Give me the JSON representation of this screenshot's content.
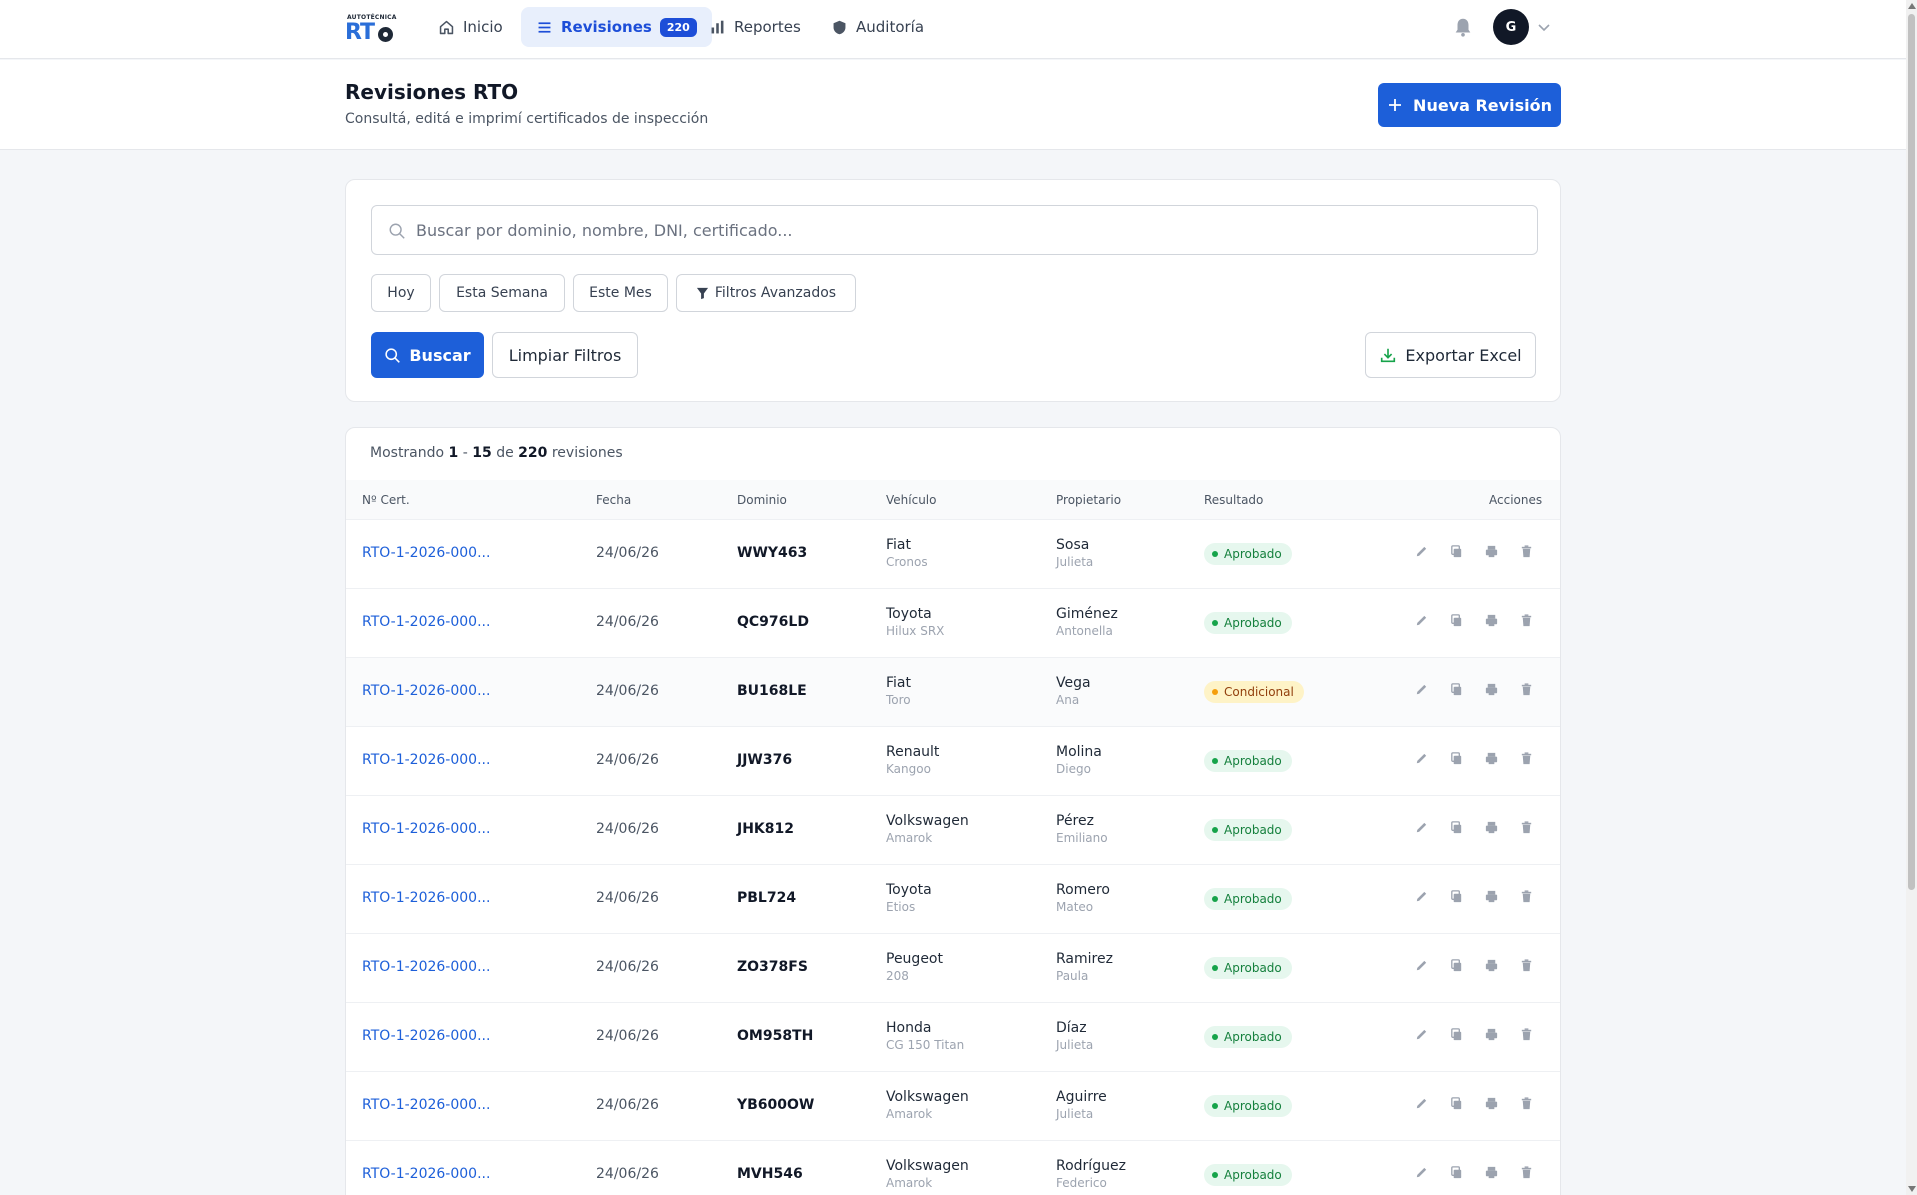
{
  "brand": {
    "top": "AUTOTÉCNICA",
    "main": "RT"
  },
  "nav": {
    "items": [
      {
        "label": "Inicio",
        "icon": "home-icon"
      },
      {
        "label": "Revisiones",
        "icon": "list-icon",
        "badge": "220",
        "active": true
      },
      {
        "label": "Reportes",
        "icon": "bar-chart-icon"
      },
      {
        "label": "Auditoría",
        "icon": "shield-icon"
      }
    ],
    "avatar": "G"
  },
  "header": {
    "title": "Revisiones RTO",
    "subtitle": "Consultá, editá e imprimí certificados de inspección",
    "new_button": "Nueva Revisión"
  },
  "filters": {
    "search_placeholder": "Buscar por dominio, nombre, DNI, certificado...",
    "quick": [
      "Hoy",
      "Esta Semana",
      "Este Mes"
    ],
    "advanced": "Filtros Avanzados",
    "search_button": "Buscar",
    "clear_button": "Limpiar Filtros",
    "export_button": "Exportar Excel"
  },
  "results": {
    "prefix": "Mostrando",
    "from": "1",
    "dash": "-",
    "to": "15",
    "of": "de",
    "total": "220",
    "suffix": "revisiones"
  },
  "table": {
    "headers": [
      "Nº Cert.",
      "Fecha",
      "Dominio",
      "Vehículo",
      "Propietario",
      "Resultado",
      "Acciones"
    ],
    "rows": [
      {
        "cert": "RTO-1-2026-000...",
        "fecha": "24/06/26",
        "dominio": "WWY463",
        "marca": "Fiat",
        "modelo": "Cronos",
        "apellido": "Sosa",
        "nombre": "Julieta",
        "resultado": "Aprobado"
      },
      {
        "cert": "RTO-1-2026-000...",
        "fecha": "24/06/26",
        "dominio": "QC976LD",
        "marca": "Toyota",
        "modelo": "Hilux SRX",
        "apellido": "Giménez",
        "nombre": "Antonella",
        "resultado": "Aprobado"
      },
      {
        "cert": "RTO-1-2026-000...",
        "fecha": "24/06/26",
        "dominio": "BU168LE",
        "marca": "Fiat",
        "modelo": "Toro",
        "apellido": "Vega",
        "nombre": "Ana",
        "resultado": "Condicional"
      },
      {
        "cert": "RTO-1-2026-000...",
        "fecha": "24/06/26",
        "dominio": "JJW376",
        "marca": "Renault",
        "modelo": "Kangoo",
        "apellido": "Molina",
        "nombre": "Diego",
        "resultado": "Aprobado"
      },
      {
        "cert": "RTO-1-2026-000...",
        "fecha": "24/06/26",
        "dominio": "JHK812",
        "marca": "Volkswagen",
        "modelo": "Amarok",
        "apellido": "Pérez",
        "nombre": "Emiliano",
        "resultado": "Aprobado"
      },
      {
        "cert": "RTO-1-2026-000...",
        "fecha": "24/06/26",
        "dominio": "PBL724",
        "marca": "Toyota",
        "modelo": "Etios",
        "apellido": "Romero",
        "nombre": "Mateo",
        "resultado": "Aprobado"
      },
      {
        "cert": "RTO-1-2026-000...",
        "fecha": "24/06/26",
        "dominio": "ZO378FS",
        "marca": "Peugeot",
        "modelo": "208",
        "apellido": "Ramirez",
        "nombre": "Paula",
        "resultado": "Aprobado"
      },
      {
        "cert": "RTO-1-2026-000...",
        "fecha": "24/06/26",
        "dominio": "OM958TH",
        "marca": "Honda",
        "modelo": "CG 150 Titan",
        "apellido": "Díaz",
        "nombre": "Julieta",
        "resultado": "Aprobado"
      },
      {
        "cert": "RTO-1-2026-000...",
        "fecha": "24/06/26",
        "dominio": "YB600OW",
        "marca": "Volkswagen",
        "modelo": "Amarok",
        "apellido": "Aguirre",
        "nombre": "Julieta",
        "resultado": "Aprobado"
      },
      {
        "cert": "RTO-1-2026-000...",
        "fecha": "24/06/26",
        "dominio": "MVH546",
        "marca": "Volkswagen",
        "modelo": "Amarok",
        "apellido": "Rodríguez",
        "nombre": "Federico",
        "resultado": "Aprobado"
      }
    ]
  },
  "colors": {
    "primary": "#1d5fd9",
    "approved": "#15803d",
    "conditional": "#92400e"
  }
}
